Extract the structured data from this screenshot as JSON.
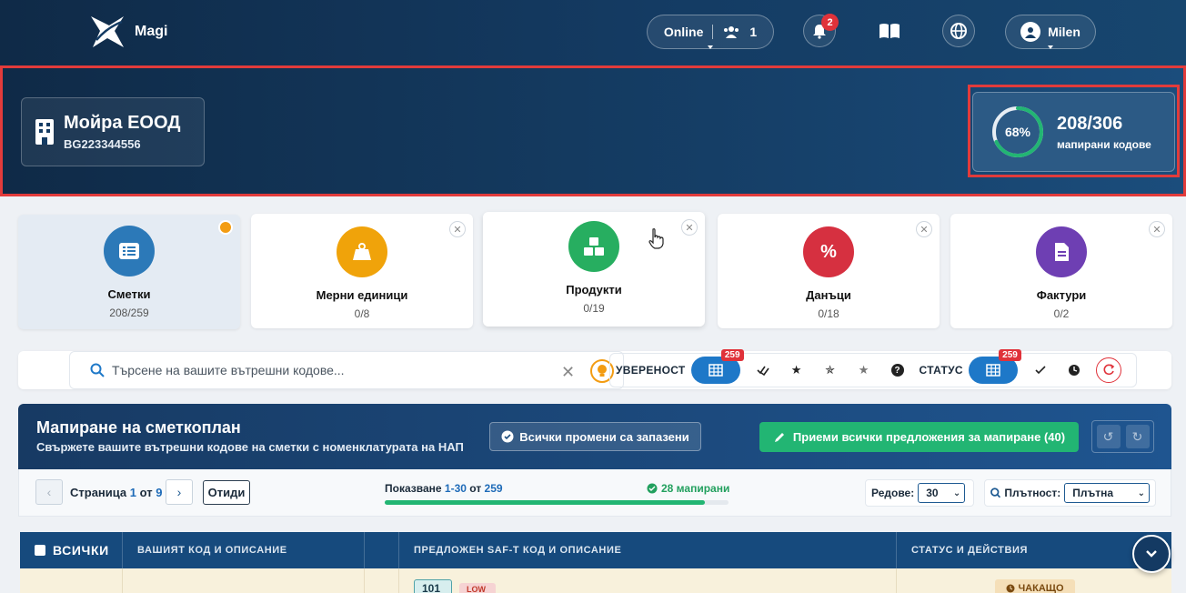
{
  "app": {
    "name": "Magi"
  },
  "topbar": {
    "online_label": "Online",
    "online_count": "1",
    "notifications_count": "2",
    "user_name": "Milen"
  },
  "company": {
    "name": "Мойра ЕООД",
    "vat": "BG223344556"
  },
  "mapping_progress": {
    "percent_label": "68%",
    "percent": 68,
    "count": "208/306",
    "subtitle": "мапирани кодове"
  },
  "categories": [
    {
      "name": "Сметки",
      "count": "208/259",
      "color": "#2c79b8"
    },
    {
      "name": "Мерни единици",
      "count": "0/8",
      "color": "#f0a30a"
    },
    {
      "name": "Продукти",
      "count": "0/19",
      "color": "#27ae60"
    },
    {
      "name": "Данъци",
      "count": "0/18",
      "color": "#d63040"
    },
    {
      "name": "Фактури",
      "count": "0/2",
      "color": "#6e3fb3"
    }
  ],
  "search": {
    "placeholder": "Търсене на вашите вътрешни кодове..."
  },
  "filters": {
    "confidence_label": "УВЕРЕНОСТ",
    "confidence_count": "259",
    "status_label": "СТАТУС",
    "status_count": "259"
  },
  "panel": {
    "title": "Мапиране на сметкоплан",
    "subtitle": "Свържете вашите вътрешни кодове на сметки с номенклатурата на НАП",
    "saved_label": "Всички промени са запазени",
    "accept_label": "Приеми всички предложения за мапиране (40)"
  },
  "pagination": {
    "page_word": "Страница",
    "current_page": "1",
    "of_word": "от",
    "total_pages": "9",
    "goto_label": "Отиди",
    "showing_word": "Показване",
    "range": "1-30",
    "range_of": "от",
    "total": "259",
    "mapped_label": "28 мапирани",
    "progress_fraction": 0.93,
    "rows_label": "Редове:",
    "rows_value": "30",
    "density_label": "Плътност:",
    "density_value": "Плътна"
  },
  "table": {
    "headers": {
      "all": "ВСИЧКИ",
      "your_code": "ВАШИЯТ КОД И ОПИСАНИЕ",
      "suggested": "ПРЕДЛОЖЕН SAF-T КОД И ОПИСАНИЕ",
      "status": "СТАТУС И ДЕЙСТВИЯ"
    },
    "rows": [
      {
        "saft_code": "101",
        "confidence": "LOW",
        "status": "ЧАКАЩО"
      }
    ]
  }
}
